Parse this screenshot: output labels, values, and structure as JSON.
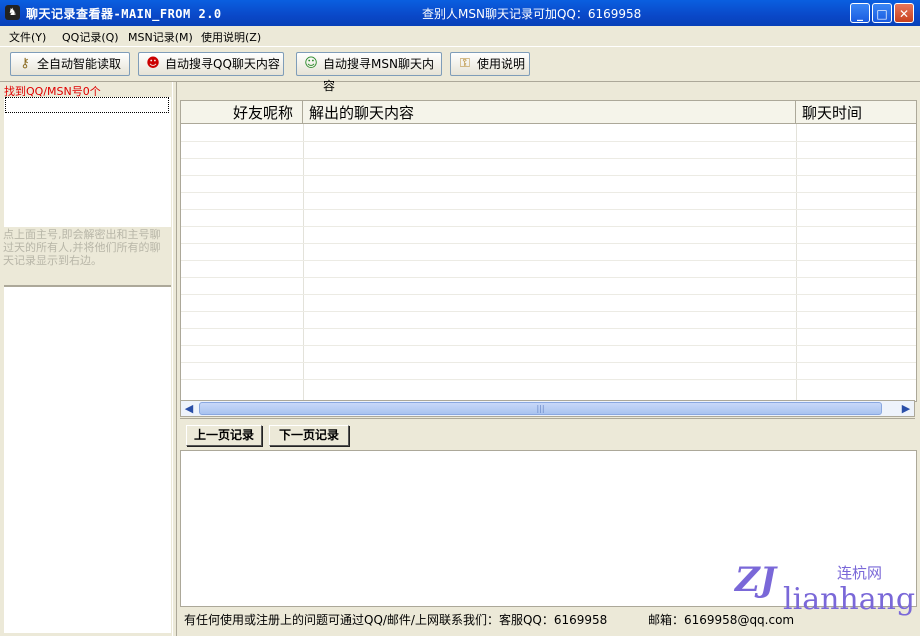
{
  "window": {
    "title": "聊天记录查看器-MAIN_FROM   2.0",
    "center_title": "查别人MSN聊天记录可加QQ：6169958",
    "controls": {
      "minimize": "_",
      "maximize": "□",
      "close": "✕"
    }
  },
  "menu": {
    "items": [
      "文件(Y)",
      "QQ记录(Q)",
      "MSN记录(M)",
      "使用说明(Z)"
    ]
  },
  "toolbar": {
    "buttons": [
      {
        "label": "全自动智能读取",
        "icon": "key-icon"
      },
      {
        "label": "自动搜寻QQ聊天内容",
        "icon": "qq-penguin-icon"
      },
      {
        "label": "自动搜寻MSN聊天内容",
        "icon": "msn-people-icon"
      },
      {
        "label": "使用说明",
        "icon": "help-key-icon"
      }
    ]
  },
  "left": {
    "found_label": "找到QQ/MSN号0个",
    "hint": "点上面主号,即会解密出和主号聊过天的所有人,并将他们所有的聊天记录显示到右边。"
  },
  "grid": {
    "columns": [
      "好友呢称",
      "解出的聊天内容",
      "聊天时间"
    ],
    "scroll_grip": "|||"
  },
  "pager": {
    "prev": "上一页记录",
    "next": "下一页记录"
  },
  "status": {
    "text": "有任何使用或注册上的问题可通过QQ/邮件/上网联系我们：客服QQ：6169958",
    "email": "邮箱：6169958@qq.com"
  },
  "watermark": {
    "logo": "ZJ",
    "name": "lianhang",
    "cn": "连杭网"
  }
}
